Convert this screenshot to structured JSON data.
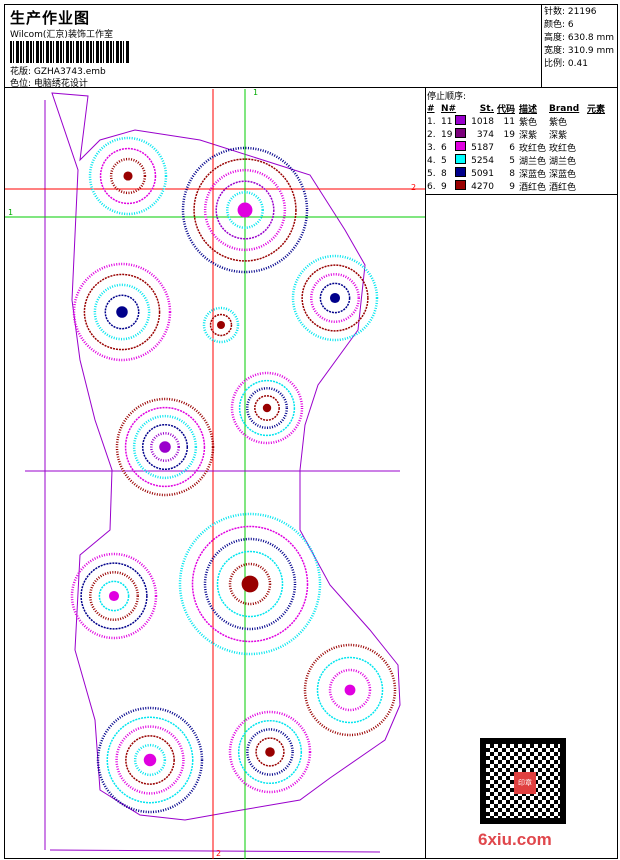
{
  "header": {
    "title": "生产作业图",
    "company": "Wilcom(汇京)装饰工作室",
    "design_label": "花版: GZHA3743.emb",
    "colorway_label": "色位: 电脑绣花设计"
  },
  "stats": {
    "stitches": "针数: 21196",
    "colors": "颜色: 6",
    "height": "高度: 630.8 mm",
    "width": "宽度: 310.9 mm",
    "scale": "比例: 0.41"
  },
  "stop_sequence": {
    "title": "停止顺序:",
    "headers": [
      "#",
      "N#",
      "St.",
      "代码",
      "描述",
      "Brand",
      "元素"
    ],
    "rows": [
      {
        "n": "1.",
        "num": "11",
        "color": "#9900cc",
        "st": "1018",
        "code": "11",
        "desc": "紫色",
        "brand": "紫色"
      },
      {
        "n": "2.",
        "num": "19",
        "color": "#7a007a",
        "st": "374",
        "code": "19",
        "desc": "深紫",
        "brand": "深紫"
      },
      {
        "n": "3.",
        "num": "6",
        "color": "#e000e0",
        "st": "5187",
        "code": "6",
        "desc": "玫红色",
        "brand": "玫红色"
      },
      {
        "n": "4.",
        "num": "5",
        "color": "#00ffff",
        "st": "5254",
        "code": "5",
        "desc": "湖兰色",
        "brand": "湖兰色"
      },
      {
        "n": "5.",
        "num": "8",
        "color": "#00008b",
        "st": "5091",
        "code": "8",
        "desc": "深蓝色",
        "brand": "深蓝色"
      },
      {
        "n": "6.",
        "num": "9",
        "color": "#990000",
        "st": "4270",
        "code": "9",
        "desc": "酒红色",
        "brand": "酒红色"
      }
    ]
  },
  "markers": {
    "green_top": "1",
    "red_right": "2",
    "green_left": "1",
    "red_bottom": "2"
  },
  "watermark": "6xiu.com",
  "qr_stamp": "印章"
}
